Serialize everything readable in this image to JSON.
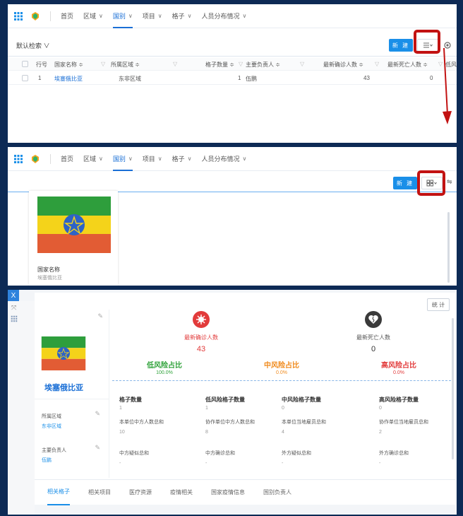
{
  "nav": {
    "items": [
      {
        "label": "首页"
      },
      {
        "label": "区域"
      },
      {
        "label": "国别"
      },
      {
        "label": "项目"
      },
      {
        "label": "格子"
      },
      {
        "label": "人员分布情况"
      }
    ]
  },
  "toolbar": {
    "new_label": "新 建",
    "default_search": "默认检索 ∨"
  },
  "table": {
    "columns": [
      "行号",
      "国家名称 ≑",
      "所属区域 ≑",
      "格子数量 ≑",
      "主要负责人 ≑",
      "最新确诊人数 ≑",
      "最新死亡人数 ≑",
      "低风险"
    ],
    "row": {
      "index": "1",
      "country": "埃塞俄比亚",
      "region": "东非区域",
      "cells": "1",
      "leader": "伍鹏",
      "confirmed": "43",
      "deaths": "0"
    }
  },
  "card": {
    "field_label": "国家名称",
    "field_value": "埃塞俄比亚"
  },
  "detail": {
    "close": "X",
    "stats_button": "统 计",
    "country_name": "埃塞俄比亚",
    "region_label": "所属区域",
    "region_value": "东非区域",
    "leader_label": "主要负责人",
    "leader_value": "伍鹏",
    "confirmed_label": "最新确诊人数",
    "confirmed_value": "43",
    "deaths_label": "最新死亡人数",
    "deaths_value": "0",
    "low_label": "低风险占比",
    "low_value": "100.0%",
    "mid_label": "中风险占比",
    "mid_value": "0.0%",
    "high_label": "高风险占比",
    "high_value": "0.0%",
    "grid": [
      {
        "label": "格子数量",
        "value": "1"
      },
      {
        "label": "低风险格子数量",
        "value": "1"
      },
      {
        "label": "中风险格子数量",
        "value": "0"
      },
      {
        "label": "高风险格子数量",
        "value": "0"
      },
      {
        "label": "本单位中方人数总和",
        "value": "10"
      },
      {
        "label": "协作单位中方人数总和",
        "value": "8"
      },
      {
        "label": "本单位当地雇员总和",
        "value": "4"
      },
      {
        "label": "协作单位当地雇员总和",
        "value": "2"
      },
      {
        "label": "中方疑似总和",
        "value": "-"
      },
      {
        "label": "中方确诊总和",
        "value": "-"
      },
      {
        "label": "外方疑似总和",
        "value": "-"
      },
      {
        "label": "外方确诊总和",
        "value": "-"
      }
    ],
    "tabs": [
      "相关格子",
      "相关项目",
      "医疗资源",
      "疫情相关",
      "国家疫情信息",
      "国别负责人"
    ]
  },
  "colors": {
    "accent": "#1a8fe8",
    "low": "#2fa23a",
    "mid": "#f08a1c",
    "high": "#e23b3b",
    "highlight": "#c21212"
  }
}
